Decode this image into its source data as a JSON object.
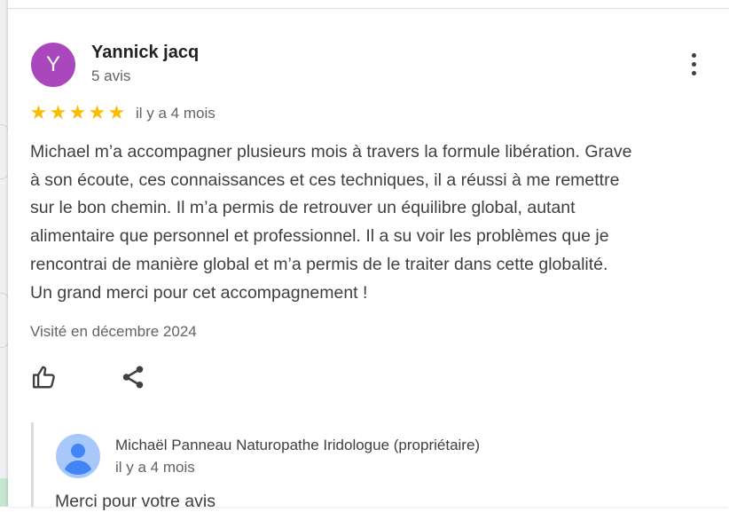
{
  "review": {
    "avatar_letter": "Y",
    "author": "Yannick jacq",
    "author_reviews": "5 avis",
    "rating": 5,
    "stars": [
      "★",
      "★",
      "★",
      "★",
      "★"
    ],
    "time": "il y a 4 mois",
    "lines": [
      "Michael m’a accompagner plusieurs mois à travers la formule libération. Grave",
      "à son écoute, ces connaissances et ces techniques, il a réussi à me remettre",
      "sur le bon chemin. Il m’a permis de retrouver un équilibre global, autant",
      "alimentaire que personnel et professionnel. Il a su voir les problèmes que je",
      "rencontrai de manière global et m’a permis de le traiter dans cette globalité.",
      "Un grand merci pour cet accompagnement !"
    ],
    "visited": "Visité en décembre 2024"
  },
  "owner_reply": {
    "author": "Michaël Panneau Naturopathe Iridologue (propriétaire)",
    "time": "il y a 4 mois",
    "text": "Merci pour votre avis"
  },
  "colors": {
    "avatar_bg": "#ab47bc",
    "star": "#fbbc04",
    "reply_avatar_bg": "#a8c7fa",
    "reply_avatar_fg": "#4285f4"
  },
  "icons": {
    "more": "more-vert-icon",
    "like": "thumb-up-icon",
    "share": "share-icon",
    "reply_avatar": "person-icon"
  }
}
